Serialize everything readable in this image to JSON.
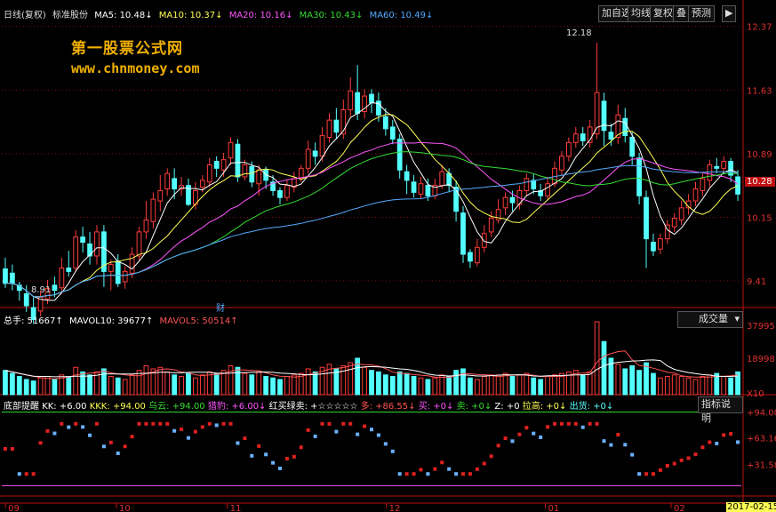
{
  "header": {
    "period": "日线(复权)",
    "indicator": "标准股份",
    "ma": [
      {
        "label": "MA5: 10.48↓",
        "color": "#ffffff"
      },
      {
        "label": "MA10: 10.37↓",
        "color": "#ffff55"
      },
      {
        "label": "MA20: 10.16↓",
        "color": "#ff55ff"
      },
      {
        "label": "MA30: 10.43↓",
        "color": "#33dd33"
      },
      {
        "label": "MA60: 10.49↓",
        "color": "#55aaff"
      }
    ]
  },
  "toolbar": {
    "buttons": [
      "加自选",
      "均线",
      "复权",
      "叠",
      "预测",
      "▶"
    ]
  },
  "watermark": {
    "title": "第一股票公式网",
    "url": "www.chnmoney.com"
  },
  "colors": {
    "up": "#ff3b3b",
    "down": "#54ffff",
    "grid": "#7a1010",
    "axis": "#c01010",
    "bg": "#000000"
  },
  "price_axis": {
    "ticks": [
      "12.37",
      "11.63",
      "10.89",
      "10.15",
      "9.41"
    ],
    "current": "10.28"
  },
  "annotations": {
    "high": "12.18",
    "low": "8.91",
    "fin": "财"
  },
  "volume_panel": {
    "items": [
      {
        "label": "总手: 51667↑",
        "color": "#ffffff"
      },
      {
        "label": "MAVOL10: 39677↑",
        "color": "#ffffff"
      },
      {
        "label": "MAVOL5: 50514↑",
        "color": "#ff5555"
      }
    ],
    "selector": "成交量",
    "axis": [
      "37995",
      "18998",
      "X10"
    ]
  },
  "indicator_panel": {
    "items": [
      {
        "label": "底部提醒",
        "color": "#ffffff"
      },
      {
        "label": "KK: +6.00",
        "color": "#ffffff"
      },
      {
        "label": "KKK: +94.00",
        "color": "#ffff55"
      },
      {
        "label": "乌云: +94.00",
        "color": "#33dd33"
      },
      {
        "label": "猎豹: +6.00↓",
        "color": "#ff55ff"
      },
      {
        "label": "红买绿卖: +☆☆☆☆☆",
        "color": "#ffffff"
      },
      {
        "label": "多: +86.55↓",
        "color": "#ff5555"
      },
      {
        "label": "买: +0↓",
        "color": "#ff55ff"
      },
      {
        "label": "卖: +0↓",
        "color": "#33dd33"
      },
      {
        "label": "Z: +0",
        "color": "#ffffff"
      },
      {
        "label": "拉高: +0↓",
        "color": "#ffff55"
      },
      {
        "label": "出货: +0↓",
        "color": "#55ffff"
      }
    ],
    "help": "指标说明",
    "axis": [
      "+94.00",
      "+63.16",
      "+31.58"
    ]
  },
  "date_axis": {
    "labels": [
      "09",
      "10",
      "11",
      "12",
      "01",
      "02"
    ],
    "current_date": "2017-02-15"
  },
  "chart_data": {
    "type": "candlestick",
    "ylim": [
      9.1,
      12.45
    ],
    "candles": [
      [
        9.55,
        9.38,
        9.68,
        9.33
      ],
      [
        9.5,
        9.38,
        9.6,
        9.3
      ],
      [
        9.36,
        9.3,
        9.4,
        9.18
      ],
      [
        9.26,
        9.12,
        9.36,
        9.05
      ],
      [
        9.1,
        8.96,
        9.22,
        8.91
      ],
      [
        9.06,
        9.22,
        9.3,
        9.0
      ],
      [
        9.2,
        9.32,
        9.42,
        9.14
      ],
      [
        9.36,
        9.3,
        9.46,
        9.22
      ],
      [
        9.33,
        9.56,
        9.68,
        9.28
      ],
      [
        9.56,
        9.52,
        9.76,
        9.46
      ],
      [
        9.56,
        9.92,
        10.0,
        9.52
      ],
      [
        9.92,
        9.86,
        10.04,
        9.74
      ],
      [
        9.84,
        9.7,
        9.98,
        9.6
      ],
      [
        9.7,
        9.98,
        10.06,
        9.6
      ],
      [
        9.98,
        9.52,
        10.06,
        9.34
      ],
      [
        9.52,
        9.6,
        9.66,
        9.3
      ],
      [
        9.64,
        9.38,
        9.72,
        9.34
      ],
      [
        9.4,
        9.52,
        9.58,
        9.32
      ],
      [
        9.5,
        9.72,
        9.8,
        9.44
      ],
      [
        9.7,
        9.98,
        10.04,
        9.64
      ],
      [
        9.98,
        10.12,
        10.34,
        9.9
      ],
      [
        10.1,
        10.36,
        10.44,
        10.02
      ],
      [
        10.34,
        10.46,
        10.64,
        10.22
      ],
      [
        10.48,
        10.66,
        10.72,
        10.4
      ],
      [
        10.6,
        10.48,
        10.72,
        10.36
      ],
      [
        10.48,
        10.52,
        10.62,
        10.4
      ],
      [
        10.52,
        10.3,
        10.6,
        10.28
      ],
      [
        10.3,
        10.46,
        10.56,
        10.24
      ],
      [
        10.5,
        10.58,
        10.64,
        10.44
      ],
      [
        10.56,
        10.76,
        10.84,
        10.5
      ],
      [
        10.8,
        10.72,
        10.86,
        10.62
      ],
      [
        10.7,
        10.82,
        10.9,
        10.62
      ],
      [
        10.84,
        11.02,
        11.08,
        10.76
      ],
      [
        11.0,
        10.62,
        11.06,
        10.56
      ],
      [
        10.62,
        10.76,
        10.82,
        10.58
      ],
      [
        10.74,
        10.56,
        10.8,
        10.5
      ],
      [
        10.54,
        10.7,
        10.76,
        10.4
      ],
      [
        10.7,
        10.58,
        10.74,
        10.48
      ],
      [
        10.56,
        10.46,
        10.64,
        10.4
      ],
      [
        10.46,
        10.38,
        10.5,
        10.3
      ],
      [
        10.38,
        10.52,
        10.58,
        10.34
      ],
      [
        10.5,
        10.6,
        10.68,
        10.44
      ],
      [
        10.6,
        10.72,
        10.76,
        10.56
      ],
      [
        10.72,
        10.94,
        11.04,
        10.66
      ],
      [
        10.92,
        10.86,
        11.02,
        10.76
      ],
      [
        10.86,
        11.1,
        11.2,
        10.8
      ],
      [
        11.08,
        11.28,
        11.36,
        11.02
      ],
      [
        11.28,
        11.14,
        11.42,
        11.06
      ],
      [
        11.12,
        11.4,
        11.52,
        11.06
      ],
      [
        11.4,
        11.62,
        11.78,
        11.32
      ],
      [
        11.6,
        11.36,
        11.92,
        11.28
      ],
      [
        11.38,
        11.56,
        11.64,
        11.3
      ],
      [
        11.58,
        11.48,
        11.64,
        11.36
      ],
      [
        11.5,
        11.34,
        11.6,
        11.26
      ],
      [
        11.32,
        11.18,
        11.42,
        11.1
      ],
      [
        11.2,
        11.06,
        11.28,
        11.0
      ],
      [
        11.06,
        10.7,
        11.12,
        10.6
      ],
      [
        10.68,
        10.58,
        10.76,
        10.42
      ],
      [
        10.56,
        10.44,
        10.64,
        10.38
      ],
      [
        10.42,
        10.54,
        10.62,
        10.36
      ],
      [
        10.52,
        10.4,
        10.6,
        10.34
      ],
      [
        10.4,
        10.52,
        10.6,
        10.36
      ],
      [
        10.52,
        10.68,
        10.76,
        10.48
      ],
      [
        10.66,
        10.52,
        10.72,
        10.44
      ],
      [
        10.5,
        10.22,
        10.58,
        10.1
      ],
      [
        10.2,
        9.72,
        10.28,
        9.62
      ],
      [
        9.74,
        9.64,
        9.78,
        9.56
      ],
      [
        9.62,
        9.8,
        9.9,
        9.58
      ],
      [
        9.8,
        9.96,
        10.06,
        9.74
      ],
      [
        9.98,
        10.14,
        10.22,
        9.92
      ],
      [
        10.12,
        10.24,
        10.36,
        10.08
      ],
      [
        10.26,
        10.38,
        10.44,
        10.18
      ],
      [
        10.38,
        10.32,
        10.46,
        10.22
      ],
      [
        10.3,
        10.46,
        10.52,
        10.24
      ],
      [
        10.46,
        10.6,
        10.66,
        10.4
      ],
      [
        10.58,
        10.48,
        10.66,
        10.42
      ],
      [
        10.46,
        10.4,
        10.54,
        10.34
      ],
      [
        10.4,
        10.54,
        10.62,
        10.36
      ],
      [
        10.54,
        10.72,
        10.8,
        10.5
      ],
      [
        10.7,
        10.86,
        10.92,
        10.64
      ],
      [
        10.86,
        11.02,
        11.08,
        10.8
      ],
      [
        11.02,
        11.12,
        11.2,
        10.96
      ],
      [
        11.12,
        11.04,
        11.2,
        10.98
      ],
      [
        11.02,
        11.2,
        11.28,
        10.96
      ],
      [
        11.12,
        11.6,
        12.18,
        11.06
      ],
      [
        11.5,
        11.16,
        11.6,
        10.98
      ],
      [
        11.14,
        11.06,
        11.24,
        10.98
      ],
      [
        11.08,
        11.34,
        11.46,
        11.0
      ],
      [
        11.3,
        11.1,
        11.42,
        11.02
      ],
      [
        11.08,
        10.86,
        11.14,
        10.76
      ],
      [
        10.84,
        10.4,
        10.9,
        10.3
      ],
      [
        10.38,
        9.9,
        10.46,
        9.56
      ],
      [
        9.86,
        9.76,
        9.96,
        9.7
      ],
      [
        9.78,
        9.9,
        9.96,
        9.72
      ],
      [
        9.9,
        10.06,
        10.12,
        9.84
      ],
      [
        10.04,
        10.14,
        10.2,
        9.98
      ],
      [
        10.12,
        10.26,
        10.34,
        10.06
      ],
      [
        10.26,
        10.34,
        10.42,
        10.18
      ],
      [
        10.34,
        10.48,
        10.56,
        10.28
      ],
      [
        10.46,
        10.6,
        10.66,
        10.4
      ],
      [
        10.58,
        10.76,
        10.82,
        10.5
      ],
      [
        10.74,
        10.72,
        10.84,
        10.66
      ],
      [
        10.72,
        10.8,
        10.86,
        10.68
      ],
      [
        10.8,
        10.64,
        10.84,
        10.56
      ],
      [
        10.62,
        10.42,
        10.7,
        10.34
      ]
    ],
    "volumes": [
      32,
      28,
      24,
      20,
      18,
      22,
      24,
      20,
      26,
      24,
      36,
      30,
      26,
      30,
      34,
      24,
      22,
      20,
      26,
      32,
      38,
      34,
      36,
      30,
      26,
      24,
      28,
      22,
      26,
      30,
      28,
      32,
      38,
      36,
      28,
      26,
      30,
      24,
      22,
      20,
      24,
      26,
      28,
      34,
      30,
      36,
      40,
      34,
      38,
      42,
      48,
      36,
      32,
      30,
      26,
      24,
      30,
      28,
      24,
      22,
      20,
      22,
      26,
      24,
      32,
      34,
      22,
      20,
      24,
      26,
      26,
      28,
      24,
      26,
      28,
      22,
      20,
      24,
      26,
      28,
      30,
      32,
      26,
      30,
      96,
      70,
      48,
      40,
      34,
      38,
      32,
      42,
      28,
      22,
      24,
      26,
      24,
      22,
      20,
      24,
      26,
      28,
      24,
      22,
      30
    ],
    "mavol_max": 37995,
    "ind_ylim": [
      0,
      100
    ]
  }
}
